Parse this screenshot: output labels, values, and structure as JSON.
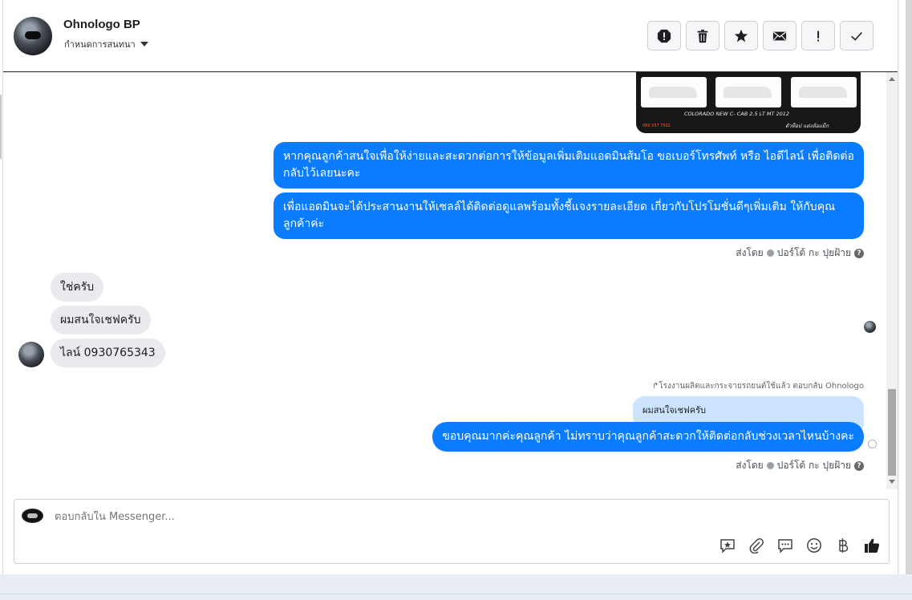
{
  "header": {
    "name": "Ohnologo BP",
    "assign_label": "กำหนดการสนทนา",
    "tools": [
      {
        "name": "mark-spam-icon"
      },
      {
        "name": "trash-icon"
      },
      {
        "name": "star-icon"
      },
      {
        "name": "mail-icon"
      },
      {
        "name": "exclamation-icon"
      },
      {
        "name": "check-icon"
      }
    ]
  },
  "image_card": {
    "caption": "COLORADO NEW C- CAB 2.5 LT MT 2012",
    "phone": "089 557 7932",
    "brand": "ตัวท็อป แต่งล้อแม็ก"
  },
  "messages": {
    "out_1": "หากคุณลูกค้าสนใจเพื่อให้ง่ายและสะดวกต่อการให้ข้อมูลเพิ่มเติมแอดมินส้มโอ ขอเบอร์โทรศัพท์ หรือ ไอดีไลน์ เพื่อติดต่อกลับไว้เลยนะคะ",
    "out_2": "เพื่อแอดมินจะได้ประสานงานให้เซลล์ได้ติดต่อดูแลพร้อมทั้งชี้แจงรายละเอียด เกี่ยวกับโปรโมชั่นดีๆเพิ่มเติม ให้กับคุณลูกค้าค่ะ",
    "sent_by_1": "ส่งโดย",
    "sender_1": "ปอร์โต้ กะ ปุยฝ้าย",
    "in_1": "ใช่ครับ",
    "in_2": "ผมสนใจเชฟครับ",
    "in_3": "ไลน์ 0930765343",
    "reply_note": "โรงงานผลิตและกระจายรถยนต์ใช้แล้ว ตอบกลับ Ohnologo",
    "quoted": "ผมสนใจเชฟครับ",
    "out_3": "ขอบคุณมากค่ะคุณลูกค้า ไม่ทราบว่าคุณลูกค้าสะดวกให้ติดต่อกลับช่วงเวลาไหนบ้างคะ",
    "sent_by_2": "ส่งโดย",
    "sender_2": "ปอร์โต้ กะ ปุยฝ้าย"
  },
  "composer": {
    "placeholder": "ตอบกลับใน Messenger...",
    "actions": [
      "saved-reply-icon",
      "attachment-icon",
      "chat-bubble-icon",
      "emoji-icon",
      "baht-icon",
      "like-icon"
    ]
  },
  "colors": {
    "outgoing_bubble": "#0a7cff",
    "incoming_bubble": "#e9eaed",
    "quoted_bubble": "#cce4ff"
  }
}
